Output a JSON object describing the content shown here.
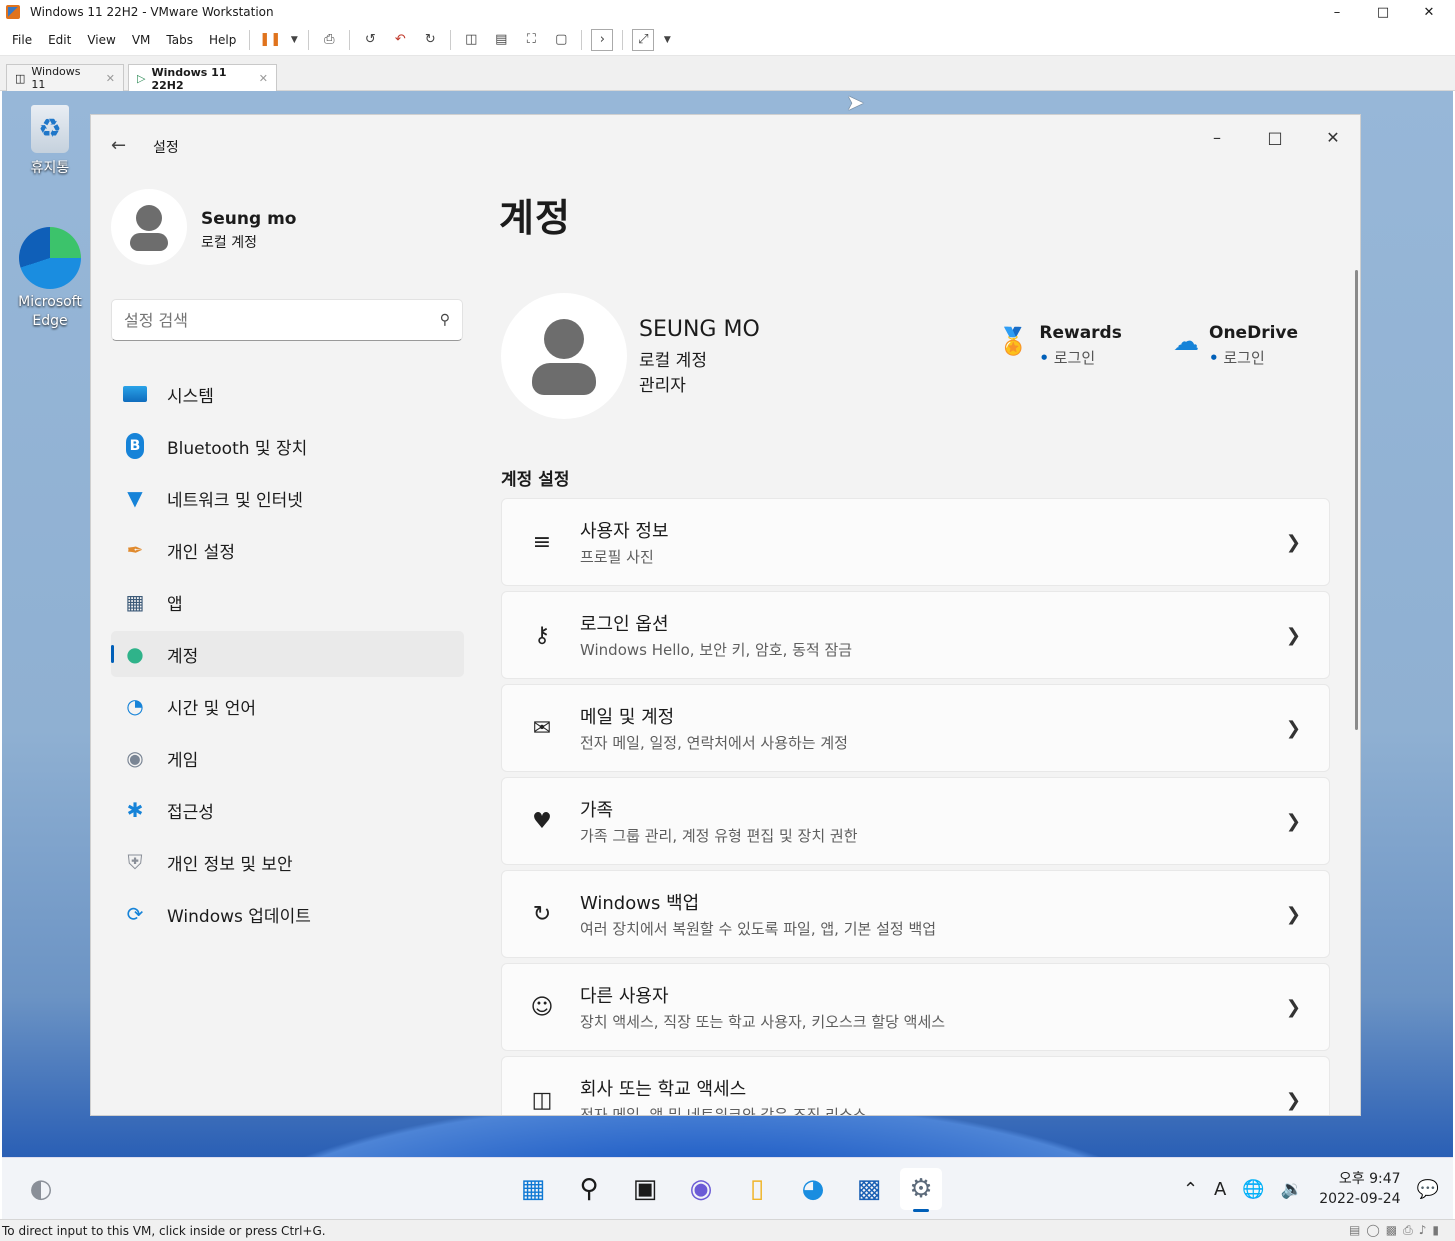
{
  "vm": {
    "window_title": "Windows 11 22H2 - VMware Workstation",
    "menu": [
      "File",
      "Edit",
      "View",
      "VM",
      "Tabs",
      "Help"
    ],
    "tabs": [
      {
        "label": "Windows 11"
      },
      {
        "label": "Windows 11 22H2"
      }
    ],
    "status_text": "To direct input to this VM, click inside or press Ctrl+G."
  },
  "desktop": {
    "icons": [
      {
        "label": "휴지통"
      },
      {
        "label": "Microsoft Edge"
      }
    ]
  },
  "settings": {
    "app_title": "설정",
    "user": {
      "name": "Seung mo",
      "type": "로컬 계정"
    },
    "search_placeholder": "설정 검색",
    "nav": [
      {
        "label": "시스템"
      },
      {
        "label": "Bluetooth 및 장치"
      },
      {
        "label": "네트워크 및 인터넷"
      },
      {
        "label": "개인 설정"
      },
      {
        "label": "앱"
      },
      {
        "label": "계정"
      },
      {
        "label": "시간 및 언어"
      },
      {
        "label": "게임"
      },
      {
        "label": "접근성"
      },
      {
        "label": "개인 정보 및 보안"
      },
      {
        "label": "Windows 업데이트"
      }
    ],
    "selected_nav": "계정",
    "page_title": "계정",
    "profile": {
      "name": "SEUNG MO",
      "type": "로컬 계정",
      "role": "관리자"
    },
    "services": [
      {
        "title": "Rewards",
        "status": "로그인"
      },
      {
        "title": "OneDrive",
        "status": "로그인"
      }
    ],
    "section_title": "계정 설정",
    "cards": [
      {
        "title": "사용자 정보",
        "subtitle": "프로필 사진"
      },
      {
        "title": "로그인 옵션",
        "subtitle": "Windows Hello, 보안 키, 암호, 동적 잠금"
      },
      {
        "title": "메일 및 계정",
        "subtitle": "전자 메일, 일정, 연락처에서 사용하는 계정"
      },
      {
        "title": "가족",
        "subtitle": "가족 그룹 관리, 계정 유형 편집 및 장치 권한"
      },
      {
        "title": "Windows 백업",
        "subtitle": "여러 장치에서 복원할 수 있도록 파일, 앱, 기본 설정 백업"
      },
      {
        "title": "다른 사용자",
        "subtitle": "장치 액세스, 직장 또는 학교 사용자, 키오스크 할당 액세스"
      },
      {
        "title": "회사 또는 학교 액세스",
        "subtitle": "전자 메일, 앱 및 네트워크와 같은 조직 리소스"
      }
    ]
  },
  "taskbar": {
    "clock_time": "오후 9:47",
    "clock_date": "2022-09-24"
  },
  "colors": {
    "accent": "#005fb8",
    "settings_bg": "#f3f3f3",
    "card_bg": "#fbfbfb"
  }
}
